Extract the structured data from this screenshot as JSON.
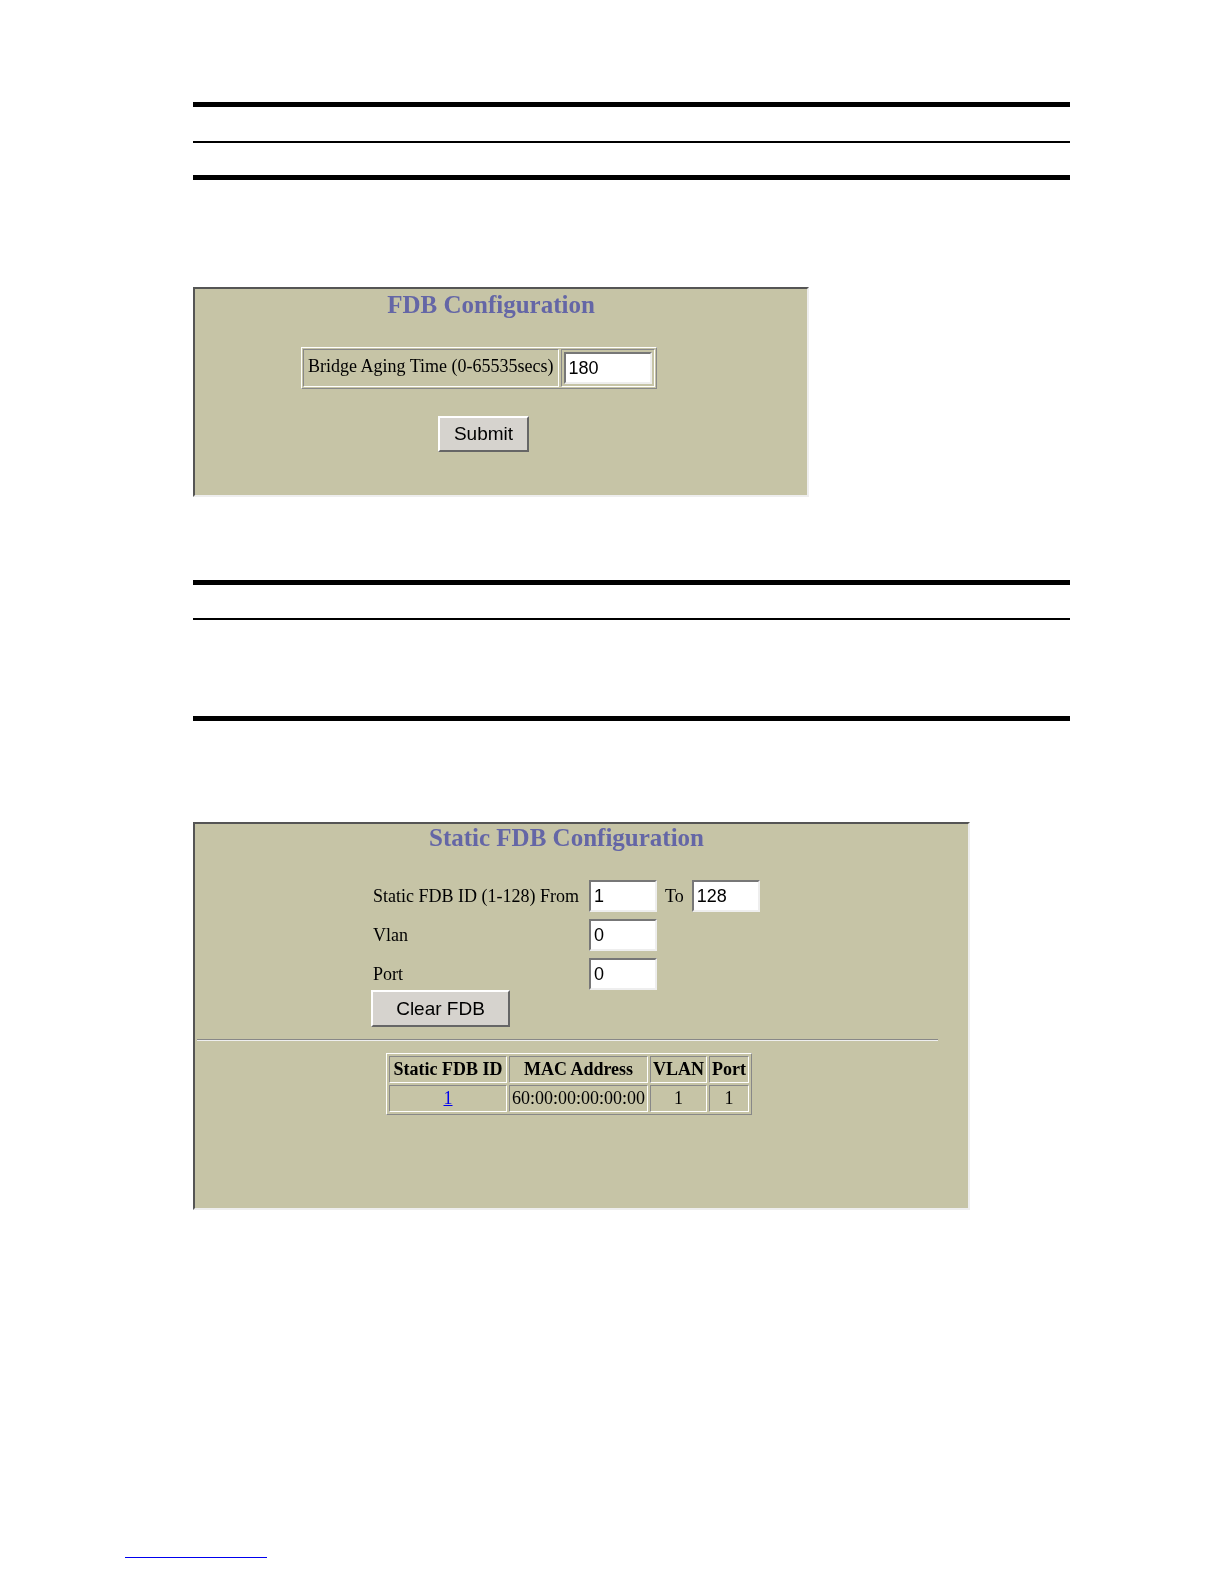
{
  "fdb_configuration": {
    "title": "FDB Configuration",
    "fields": [
      {
        "label": "Bridge Aging Time (0-65535secs)",
        "value": "180"
      }
    ],
    "submit_button": "Submit"
  },
  "static_fdb_configuration": {
    "title": "Static FDB Configuration",
    "id_range": {
      "label": "Static FDB ID (1-128) From",
      "from_value": "1",
      "to_label": "To",
      "to_value": "128"
    },
    "fields": [
      {
        "label": "Vlan",
        "value": "0"
      },
      {
        "label": "Port",
        "value": "0"
      }
    ],
    "clear_button": "Clear FDB",
    "table": {
      "columns": [
        "Static FDB ID",
        "MAC Address",
        "VLAN",
        "Port"
      ],
      "rows": [
        [
          "1",
          "60:00:00:00:00:00",
          "1",
          "1"
        ]
      ]
    }
  }
}
